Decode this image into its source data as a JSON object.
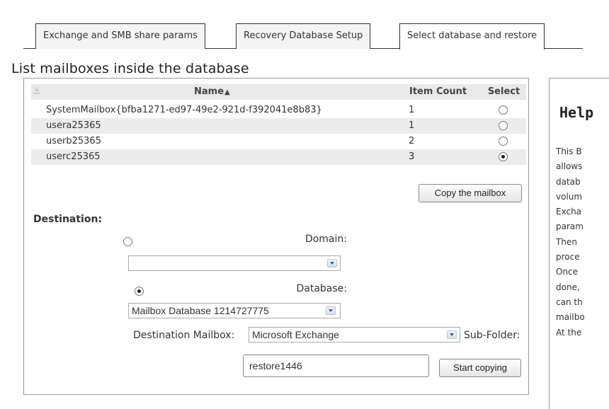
{
  "tabs": [
    {
      "label": "Exchange and SMB share params",
      "active": false
    },
    {
      "label": "Recovery Database Setup",
      "active": false
    },
    {
      "label": "Select database and restore",
      "active": true
    }
  ],
  "mailbox_list": {
    "legend": "List mailboxes inside the database",
    "columns": {
      "name": "Name",
      "sort_indicator": "▲",
      "item_count": "Item Count",
      "select": "Select"
    },
    "rows": [
      {
        "name": "SystemMailbox{bfba1271-ed97-49e2-921d-f392041e8b83}",
        "item_count": "1",
        "selected": false
      },
      {
        "name": "usera25365",
        "item_count": "1",
        "selected": false
      },
      {
        "name": "userb25365",
        "item_count": "2",
        "selected": false
      },
      {
        "name": "userc25365",
        "item_count": "3",
        "selected": true
      }
    ],
    "copy_button": "Copy the mailbox"
  },
  "destination": {
    "heading": "Destination:",
    "domain_label": "Domain:",
    "domain_selected": false,
    "domain_value": "",
    "database_label": "Database:",
    "database_selected": true,
    "database_value": "Mailbox Database 1214727775",
    "mailbox_label": "Destination Mailbox:",
    "mailbox_value": "Microsoft Exchange",
    "subfolder_label": "Sub-Folder:",
    "subfolder_value": "restore1446",
    "start_button": "Start copying"
  },
  "help": {
    "title": "Help",
    "lines": [
      "This B",
      "allows",
      "datab",
      "volum",
      "Excha",
      "param",
      "Then",
      "proce",
      "Once",
      "done,",
      "can th",
      "mailbo",
      "At the"
    ]
  }
}
